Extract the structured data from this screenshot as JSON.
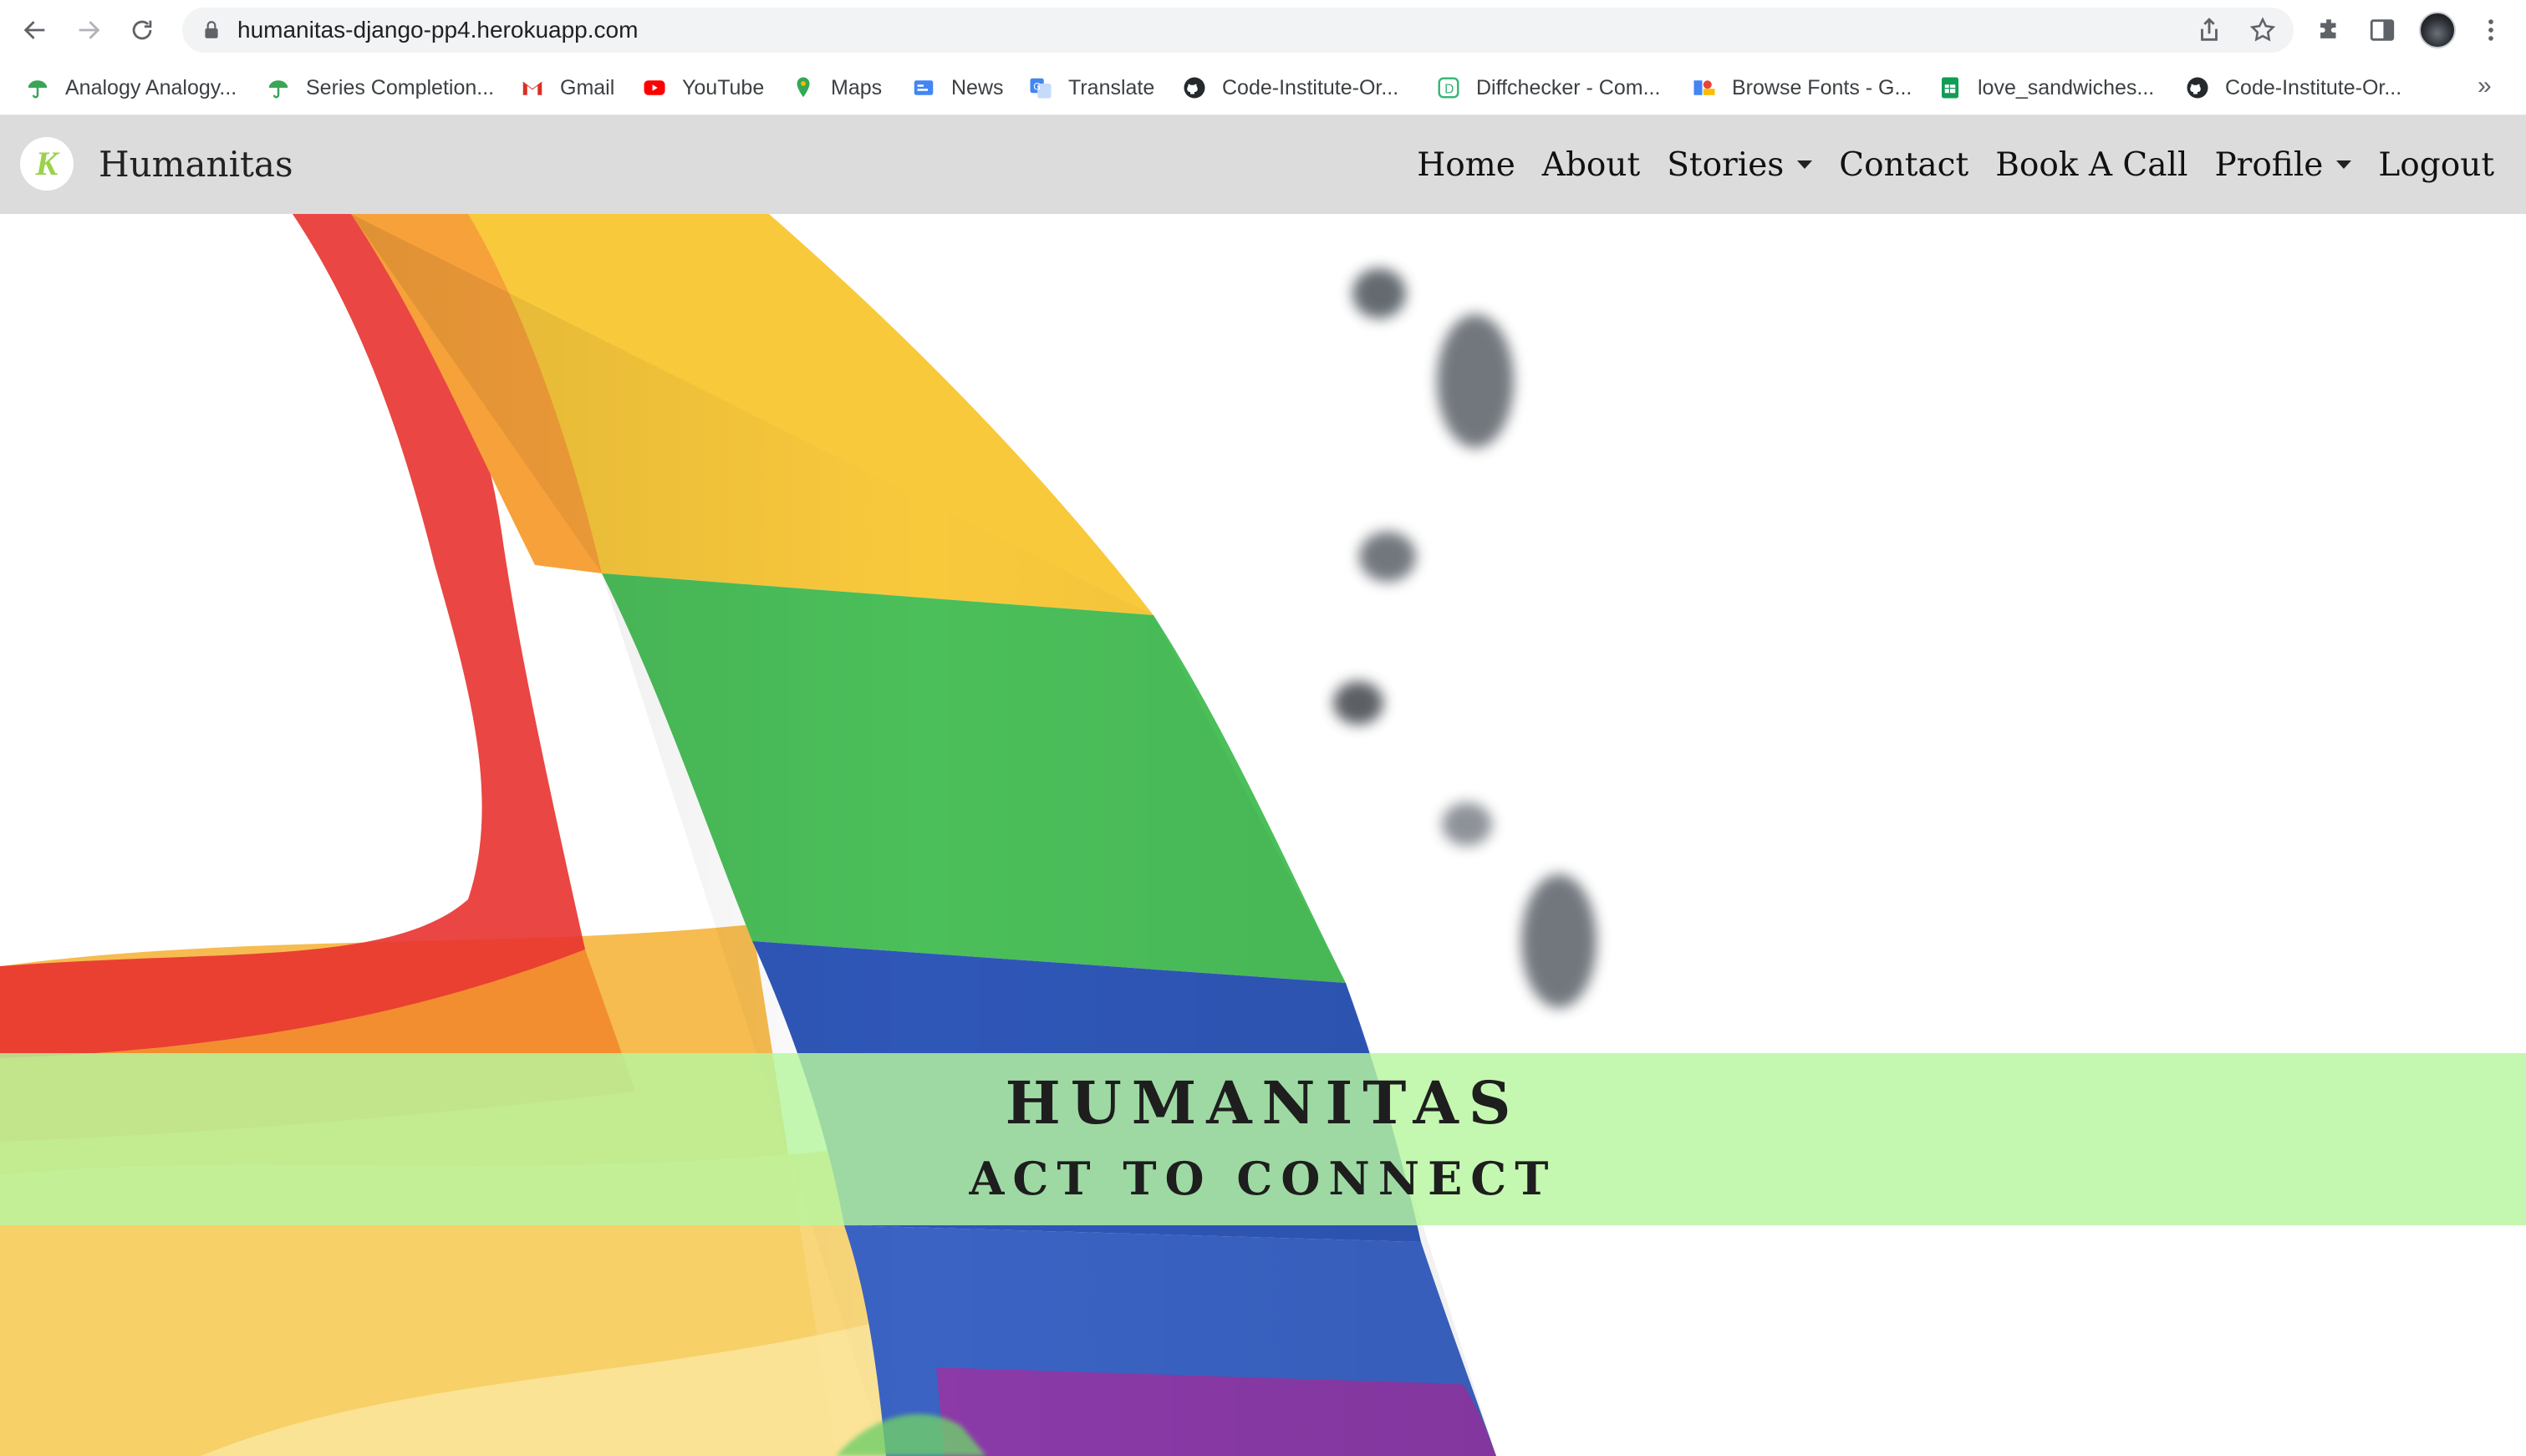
{
  "browser": {
    "url": "humanitas-django-pp4.herokuapp.com",
    "bookmarks": [
      {
        "label": "Analogy Analogy...",
        "icon": "umbrella-icon"
      },
      {
        "label": "Series Completion...",
        "icon": "umbrella-icon"
      },
      {
        "label": "Gmail",
        "icon": "gmail-icon"
      },
      {
        "label": "YouTube",
        "icon": "youtube-icon"
      },
      {
        "label": "Maps",
        "icon": "maps-pin-icon"
      },
      {
        "label": "News",
        "icon": "news-icon"
      },
      {
        "label": "Translate",
        "icon": "translate-icon"
      },
      {
        "label": "Code-Institute-Or...",
        "icon": "github-icon"
      },
      {
        "label": "Diffchecker - Com...",
        "icon": "diffchecker-icon"
      },
      {
        "label": "Browse Fonts - G...",
        "icon": "google-fonts-icon"
      },
      {
        "label": "love_sandwiches...",
        "icon": "sheets-icon"
      },
      {
        "label": "Code-Institute-Or...",
        "icon": "github-icon"
      }
    ],
    "more": "»"
  },
  "site": {
    "brand": "Humanitas",
    "logo_letter": "K",
    "nav": {
      "home": "Home",
      "about": "About",
      "stories": "Stories",
      "contact": "Contact",
      "book": "Book A Call",
      "profile": "Profile",
      "logout": "Logout"
    },
    "hero": {
      "title": "HUMANITAS",
      "subtitle": "ACT TO CONNECT"
    }
  },
  "colors": {
    "navbar": "#dcdcdc",
    "banner": "#b7f7a0",
    "logo_accent": "#9bd24a"
  }
}
